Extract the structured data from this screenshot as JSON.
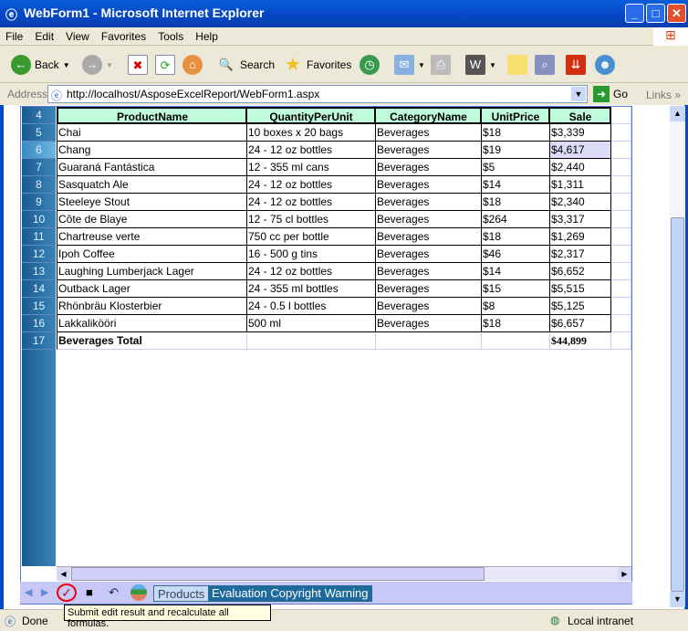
{
  "window": {
    "title": "WebForm1 - Microsoft Internet Explorer",
    "icon": "ie-icon"
  },
  "menu": [
    "File",
    "Edit",
    "View",
    "Favorites",
    "Tools",
    "Help"
  ],
  "toolbar": {
    "back": "Back",
    "search": "Search",
    "favorites": "Favorites"
  },
  "address": {
    "label": "Address",
    "url": "http://localhost/AsposeExcelReport/WebForm1.aspx",
    "go": "Go",
    "links": "Links"
  },
  "sheet": {
    "header_row": "4",
    "columns": [
      "ProductName",
      "QuantityPerUnit",
      "CategoryName",
      "UnitPrice",
      "Sale"
    ],
    "rows": [
      {
        "n": "5",
        "c": [
          "Chai",
          "10 boxes x 20 bags",
          "Beverages",
          "$18",
          "$3,339"
        ]
      },
      {
        "n": "6",
        "c": [
          "Chang",
          "24 - 12 oz bottles",
          "Beverages",
          "$19",
          "$4,617"
        ]
      },
      {
        "n": "7",
        "c": [
          "Guaraná Fantástica",
          "12 - 355 ml cans",
          "Beverages",
          "$5",
          "$2,440"
        ]
      },
      {
        "n": "8",
        "c": [
          "Sasquatch Ale",
          "24 - 12 oz bottles",
          "Beverages",
          "$14",
          "$1,311"
        ]
      },
      {
        "n": "9",
        "c": [
          "Steeleye Stout",
          "24 - 12 oz bottles",
          "Beverages",
          "$18",
          "$2,340"
        ]
      },
      {
        "n": "10",
        "c": [
          "Côte de Blaye",
          "12 - 75 cl bottles",
          "Beverages",
          "$264",
          "$3,317"
        ]
      },
      {
        "n": "11",
        "c": [
          "Chartreuse verte",
          "750 cc per bottle",
          "Beverages",
          "$18",
          "$1,269"
        ]
      },
      {
        "n": "12",
        "c": [
          "Ipoh Coffee",
          "16 - 500 g tins",
          "Beverages",
          "$46",
          "$2,317"
        ]
      },
      {
        "n": "13",
        "c": [
          "Laughing Lumberjack Lager",
          "24 - 12 oz bottles",
          "Beverages",
          "$14",
          "$6,652"
        ]
      },
      {
        "n": "14",
        "c": [
          "Outback Lager",
          "24 - 355 ml bottles",
          "Beverages",
          "$15",
          "$5,515"
        ]
      },
      {
        "n": "15",
        "c": [
          "Rhönbräu Klosterbier",
          "24 - 0.5 l bottles",
          "Beverages",
          "$8",
          "$5,125"
        ]
      },
      {
        "n": "16",
        "c": [
          "Lakkalikööri",
          "500 ml",
          "Beverages",
          "$18",
          "$6,657"
        ]
      }
    ],
    "total": {
      "n": "17",
      "label": "Beverages Total",
      "sale": "$44,899"
    },
    "selected_cell": "Sale row 6",
    "header_color": "#c0fcdc"
  },
  "tabs": [
    "Products",
    "Evaluation Copyright Warning"
  ],
  "tooltip": "Submit edit result and recalculate all formulas.",
  "status": {
    "text": "Done",
    "zone": "Local intranet"
  }
}
